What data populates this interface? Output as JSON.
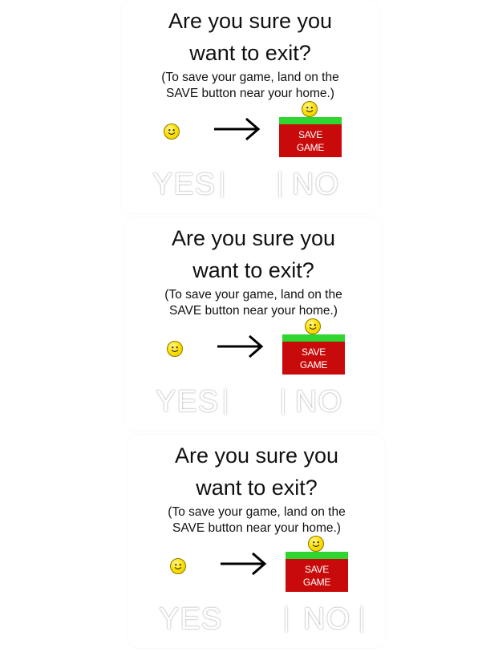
{
  "dialogs": [
    {
      "title_line1": "Are you sure you",
      "title_line2": "want to exit?",
      "subtitle_line1": "(To save your game, land on the",
      "subtitle_line2": "SAVE button near your home.)",
      "save_line1": "SAVE",
      "save_line2": "GAME",
      "yes_label": "YES",
      "no_label": "NO"
    },
    {
      "title_line1": "Are you sure you",
      "title_line2": "want to exit?",
      "subtitle_line1": "(To save your game, land on the",
      "subtitle_line2": "SAVE button near your home.)",
      "save_line1": "SAVE",
      "save_line2": "GAME",
      "yes_label": "YES",
      "no_label": "NO"
    },
    {
      "title_line1": "Are you sure you",
      "title_line2": "want to exit?",
      "subtitle_line1": "(To save your game, land on the",
      "subtitle_line2": "SAVE button near your home.)",
      "save_line1": "SAVE",
      "save_line2": "GAME",
      "yes_label": "YES",
      "no_label": "NO"
    }
  ],
  "icons": {
    "player": "smiley-icon",
    "direction": "right-arrow-icon"
  },
  "colors": {
    "save_red": "#c90a0a",
    "save_green": "#2fd62f",
    "smiley_yellow": "#ffe100"
  }
}
